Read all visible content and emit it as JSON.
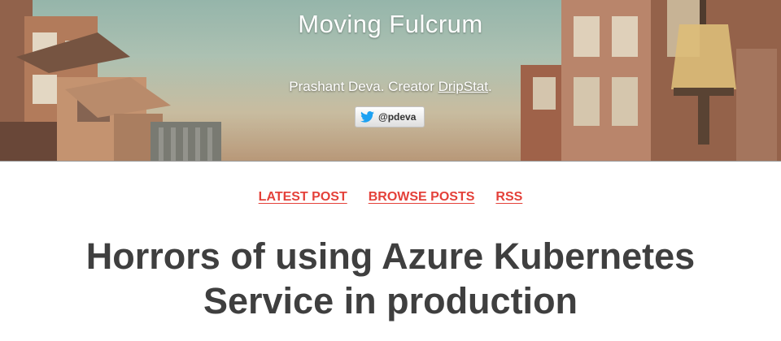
{
  "header": {
    "site_title": "Moving Fulcrum",
    "tagline_prefix": "Prashant Deva. Creator ",
    "tagline_link": "DripStat",
    "tagline_suffix": ".",
    "twitter_handle": "@pdeva",
    "twitter_icon": "twitter-bird-icon",
    "background": "street-buildings-photo"
  },
  "nav": {
    "items": [
      {
        "label": "LATEST POST"
      },
      {
        "label": "BROWSE POSTS"
      },
      {
        "label": "RSS"
      }
    ]
  },
  "post": {
    "title": "Horrors of using Azure Kubernetes Service in production"
  },
  "colors": {
    "nav_link": "#e4413a",
    "title_text": "#3f3f3f",
    "twitter_blue": "#1da1f2"
  }
}
